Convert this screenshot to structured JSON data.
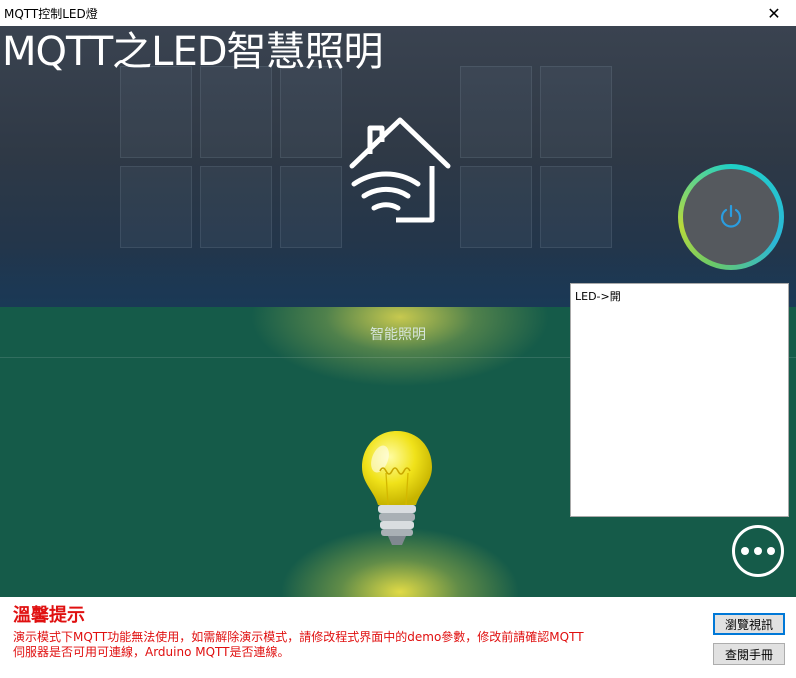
{
  "window": {
    "title": "MQTT控制LED燈",
    "close_symbol": "✕"
  },
  "hero": {
    "title": "MQTT之LED智慧照明"
  },
  "panel": {
    "section_label": "智能照明"
  },
  "log": {
    "lines": [
      "LED->開"
    ]
  },
  "notice": {
    "heading": "溫馨提示",
    "body_line1": "演示模式下MQTT功能無法使用，如需解除演示模式，請修改程式界面中的demo參數，修改前請確認MQTT",
    "body_line2": "伺服器是否可用可連線，Arduino MQTT是否連線。"
  },
  "buttons": {
    "browse": "瀏覽視訊",
    "manual": "查閱手冊"
  },
  "colors": {
    "panel_green": "#155b49",
    "notice_red": "#e01010",
    "ring_cyan": "#1fd0c7",
    "ring_lime": "#b8d93b",
    "power_icon": "#2a9de0"
  },
  "icons": [
    "smart-home-wifi-icon",
    "power-icon",
    "light-bulb-icon",
    "more-icon"
  ]
}
